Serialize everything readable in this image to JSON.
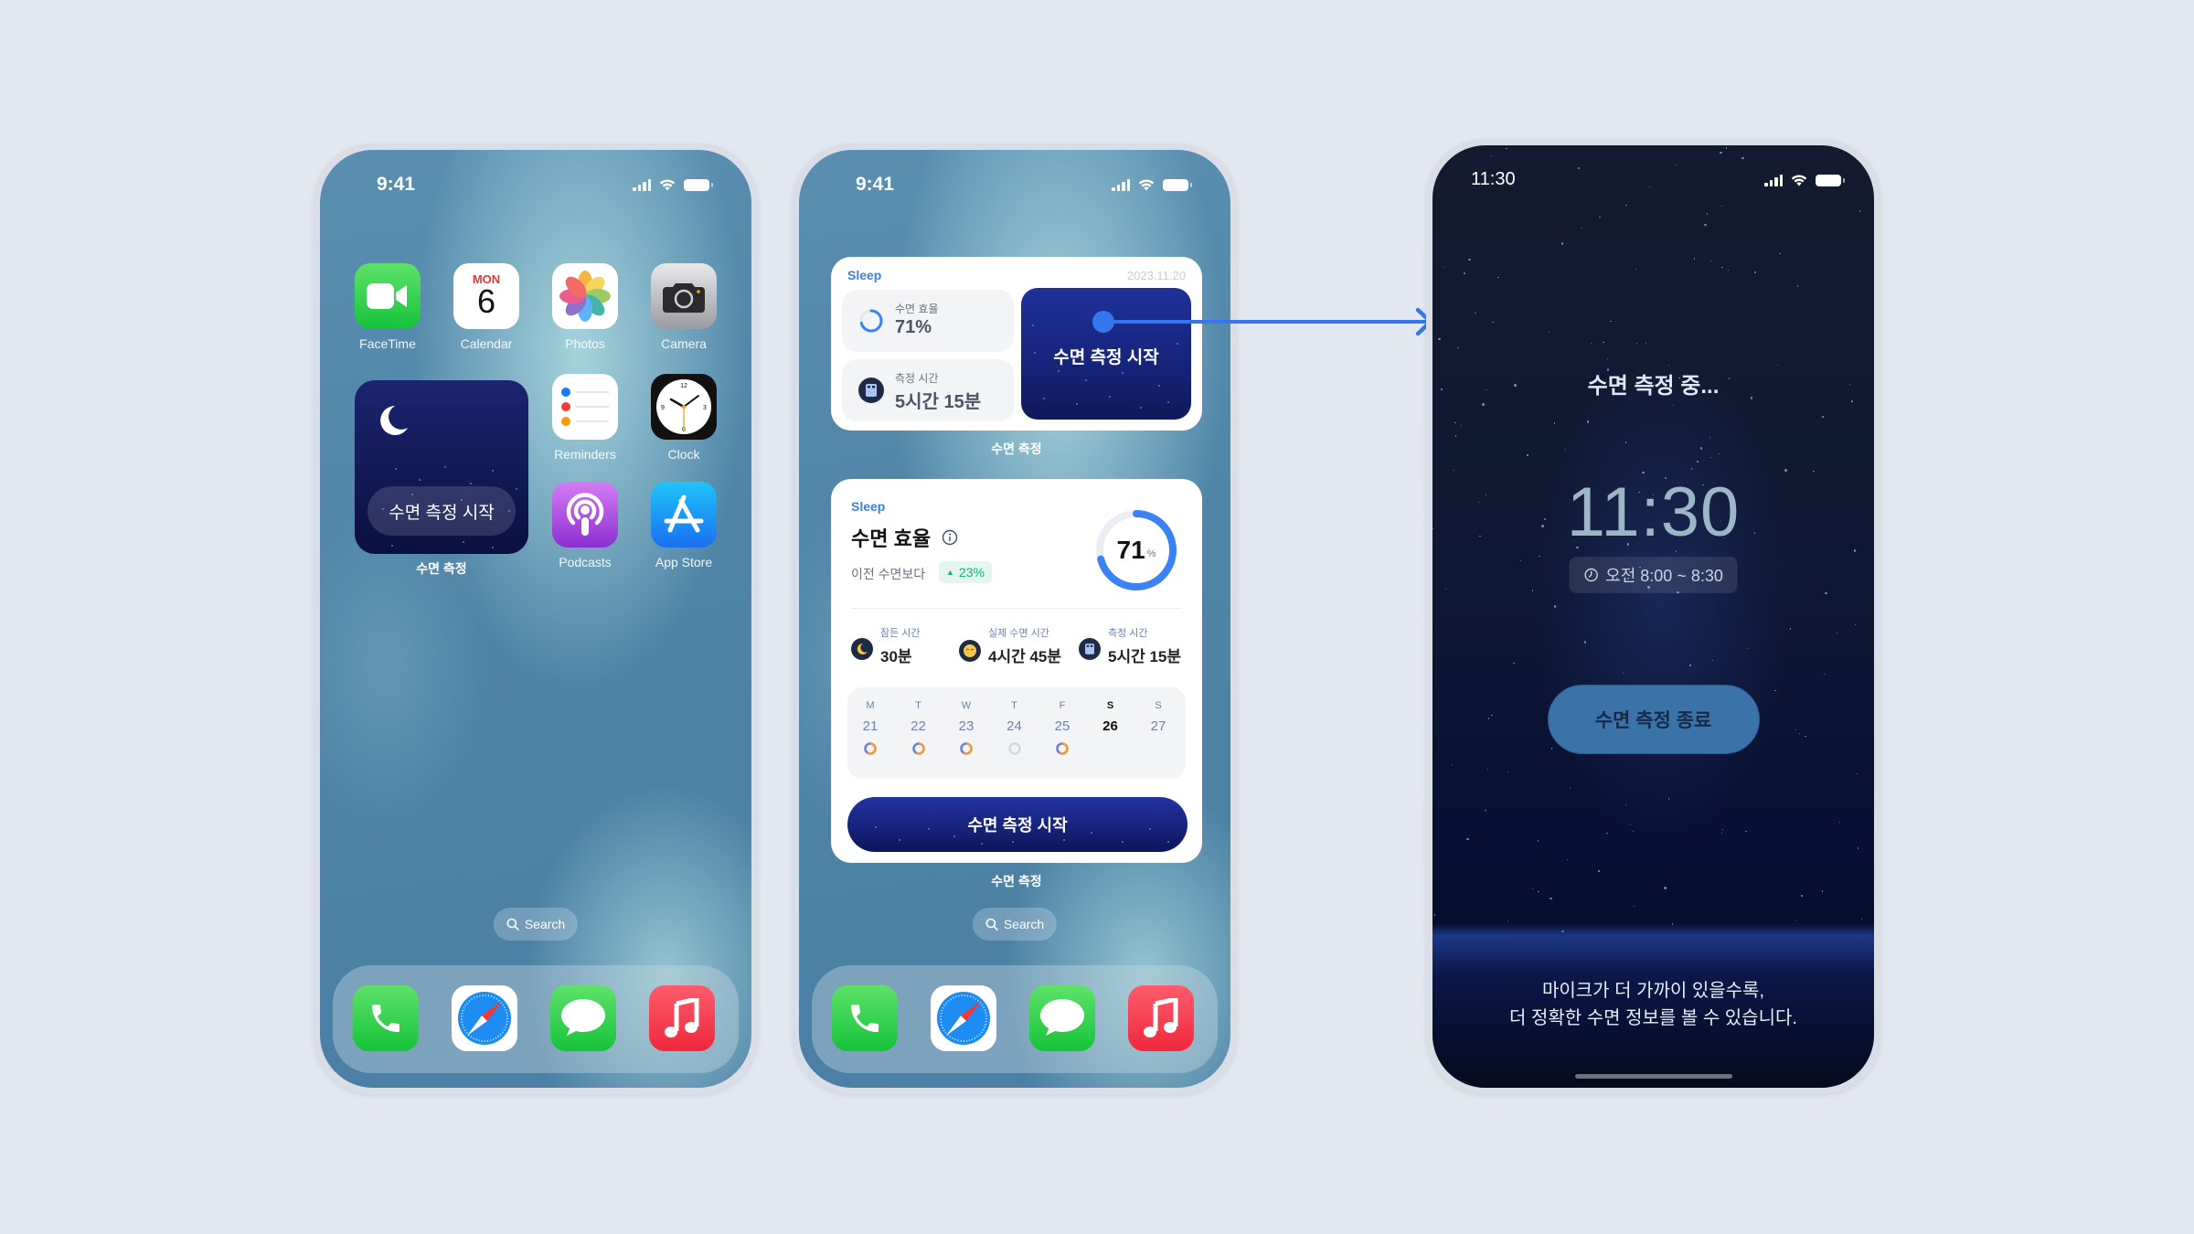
{
  "colors": {
    "background": "#e3e8f0",
    "accent_blue": "#3f7fe0",
    "ring_blue": "#3b82f6",
    "badge_green": "#16b27a",
    "night_button": "#3b73a8"
  },
  "phone1": {
    "status": {
      "time": "9:41",
      "icons": [
        "signal-icon",
        "wifi-icon",
        "battery-icon"
      ]
    },
    "apps": [
      {
        "label": "FaceTime",
        "icon": "facetime-icon"
      },
      {
        "label": "Calendar",
        "icon": "calendar-icon",
        "month": "MON",
        "day": "6"
      },
      {
        "label": "Photos",
        "icon": "photos-icon"
      },
      {
        "label": "Camera",
        "icon": "camera-icon"
      },
      {
        "label": "Reminders",
        "icon": "reminders-icon"
      },
      {
        "label": "Clock",
        "icon": "clock-icon"
      },
      {
        "label": "Podcasts",
        "icon": "podcasts-icon"
      },
      {
        "label": "App Store",
        "icon": "app-store-icon"
      }
    ],
    "widget": {
      "button_label": "수면 측정 시작",
      "caption": "수면 측정",
      "icon": "moon-icon"
    },
    "search_label": "Search",
    "dock": [
      {
        "name": "Phone",
        "icon": "phone-icon"
      },
      {
        "name": "Safari",
        "icon": "safari-icon"
      },
      {
        "name": "Messages",
        "icon": "messages-icon"
      },
      {
        "name": "Music",
        "icon": "music-icon"
      }
    ]
  },
  "phone2": {
    "status": {
      "time": "9:41"
    },
    "medium_widget": {
      "tag": "Sleep",
      "date": "2023.11.20",
      "efficiency_label": "수면 효율",
      "efficiency_value": "71%",
      "efficiency_fraction": 0.71,
      "duration_label": "측정 시간",
      "duration_value": "5시간 15분",
      "start_label": "수면 측정 시작",
      "caption": "수면 측정"
    },
    "large_widget": {
      "tag": "Sleep",
      "title": "수면 효율",
      "compare_label": "이전 수면보다",
      "compare_delta": "23%",
      "score": "71",
      "score_unit": "%",
      "score_fraction": 0.71,
      "stats": [
        {
          "label": "잠든 시간",
          "value": "30분",
          "icon": "moon-icon"
        },
        {
          "label": "실제 수면 시간",
          "value": "4시간 45분",
          "icon": "sleeping-face-icon"
        },
        {
          "label": "측정 시간",
          "value": "5시간 15분",
          "icon": "bed-icon"
        }
      ],
      "week": [
        {
          "day": "M",
          "date": "21",
          "has_ring": true,
          "today": false
        },
        {
          "day": "T",
          "date": "22",
          "has_ring": true,
          "today": false
        },
        {
          "day": "W",
          "date": "23",
          "has_ring": true,
          "today": false
        },
        {
          "day": "T",
          "date": "24",
          "has_ring": true,
          "empty": true,
          "today": false
        },
        {
          "day": "F",
          "date": "25",
          "has_ring": true,
          "today": false
        },
        {
          "day": "S",
          "date": "26",
          "has_ring": false,
          "today": true
        },
        {
          "day": "S",
          "date": "27",
          "has_ring": false,
          "today": false
        }
      ],
      "start_label": "수면 측정 시작",
      "caption": "수면 측정"
    },
    "search_label": "Search"
  },
  "phone3": {
    "status": {
      "time": "11:30"
    },
    "title": "수면 측정 중...",
    "clock": "11:30",
    "alarm_range": "오전 8:00 ~ 8:30",
    "stop_label": "수면 측정 종료",
    "tip_line1": "마이크가 더 가까이 있을수록,",
    "tip_line2": "더 정확한 수면 정보를 볼 수 있습니다."
  }
}
